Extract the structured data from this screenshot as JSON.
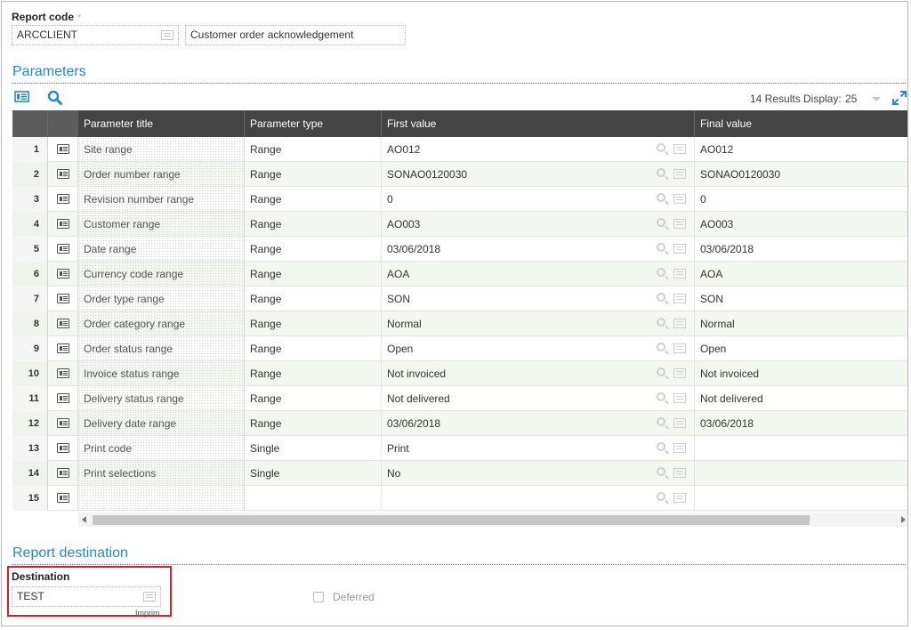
{
  "report_code": {
    "label": "Report code",
    "required_mark": "*",
    "code_value": "ARCCLIENT",
    "description_value": "Customer order acknowledgement"
  },
  "parameters": {
    "section_title": "Parameters",
    "results_text": "14 Results",
    "display_label": "Display:",
    "display_value": "25",
    "columns": {
      "title": "Parameter title",
      "type": "Parameter type",
      "first": "First value",
      "final": "Final value"
    },
    "rows": [
      {
        "num": "1",
        "title": "Site range",
        "type": "Range",
        "first": "AO012",
        "final": "AO012"
      },
      {
        "num": "2",
        "title": "Order number range",
        "type": "Range",
        "first": "SONAO0120030",
        "final": "SONAO0120030"
      },
      {
        "num": "3",
        "title": "Revision number range",
        "type": "Range",
        "first": "0",
        "final": "0"
      },
      {
        "num": "4",
        "title": "Customer range",
        "type": "Range",
        "first": "AO003",
        "final": "AO003"
      },
      {
        "num": "5",
        "title": "Date range",
        "type": "Range",
        "first": "03/06/2018",
        "final": "03/06/2018"
      },
      {
        "num": "6",
        "title": "Currency code range",
        "type": "Range",
        "first": "AOA",
        "final": "AOA"
      },
      {
        "num": "7",
        "title": "Order type range",
        "type": "Range",
        "first": "SON",
        "final": "SON"
      },
      {
        "num": "8",
        "title": "Order category range",
        "type": "Range",
        "first": "Normal",
        "final": "Normal"
      },
      {
        "num": "9",
        "title": "Order status range",
        "type": "Range",
        "first": "Open",
        "final": "Open"
      },
      {
        "num": "10",
        "title": "Invoice status range",
        "type": "Range",
        "first": "Not invoiced",
        "final": "Not invoiced"
      },
      {
        "num": "11",
        "title": "Delivery status range",
        "type": "Range",
        "first": "Not delivered",
        "final": "Not delivered"
      },
      {
        "num": "12",
        "title": "Delivery date range",
        "type": "Range",
        "first": "03/06/2018",
        "final": "03/06/2018"
      },
      {
        "num": "13",
        "title": "Print code",
        "type": "Single",
        "first": "Print",
        "final": ""
      },
      {
        "num": "14",
        "title": "Print selections",
        "type": "Single",
        "first": "No",
        "final": ""
      },
      {
        "num": "15",
        "title": "",
        "type": "",
        "first": "",
        "final": ""
      }
    ]
  },
  "destination": {
    "section_title": "Report destination",
    "label": "Destination",
    "value": "TEST",
    "sub_label": "Imprim",
    "deferred_label": "Deferred"
  },
  "colors": {
    "accent": "#1f8dc7",
    "header_bg": "#444444",
    "highlight": "#d6202a"
  }
}
